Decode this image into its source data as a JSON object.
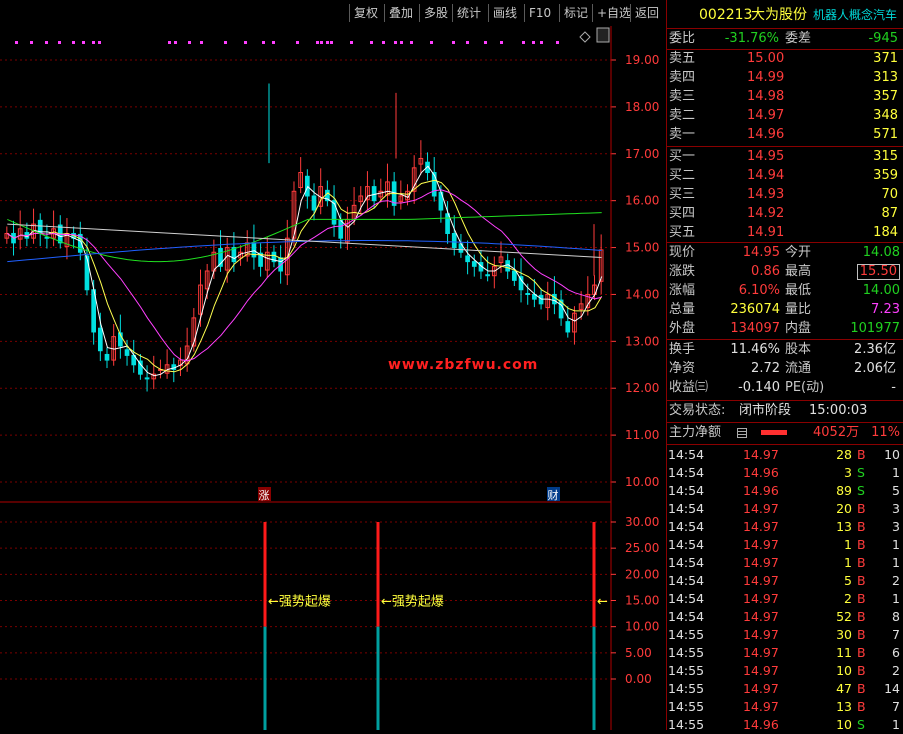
{
  "toolbar": {
    "buttons": [
      "复权",
      "叠加",
      "多股",
      "统计",
      "画线",
      "F10",
      "标记",
      "+自选",
      "返回"
    ]
  },
  "chart": {
    "price_axis": [
      "19.00",
      "18.00",
      "17.00",
      "16.00",
      "15.00",
      "14.00",
      "13.00",
      "12.00",
      "11.00",
      "10.00"
    ],
    "indicator_axis": [
      "30.00",
      "25.00",
      "20.00",
      "15.00",
      "10.00",
      "5.00",
      "0.00"
    ],
    "markers": [
      "涨",
      "财"
    ],
    "signal_label": "←强势起爆",
    "signal_arrow_label": "←",
    "watermark": "www.zbzfwu.com"
  },
  "quote": {
    "code": "002213",
    "name": "大为股份",
    "concept": "机器人概念汽车",
    "weibi_label": "委比",
    "weibi_value": "-31.76%",
    "weicha_label": "委差",
    "weicha_value": "-945",
    "asks": [
      {
        "label": "卖五",
        "price": "15.00",
        "vol": "371"
      },
      {
        "label": "卖四",
        "price": "14.99",
        "vol": "313"
      },
      {
        "label": "卖三",
        "price": "14.98",
        "vol": "357"
      },
      {
        "label": "卖二",
        "price": "14.97",
        "vol": "348"
      },
      {
        "label": "卖一",
        "price": "14.96",
        "vol": "571"
      }
    ],
    "bids": [
      {
        "label": "买一",
        "price": "14.95",
        "vol": "315"
      },
      {
        "label": "买二",
        "price": "14.94",
        "vol": "359"
      },
      {
        "label": "买三",
        "price": "14.93",
        "vol": "70"
      },
      {
        "label": "买四",
        "price": "14.92",
        "vol": "87"
      },
      {
        "label": "买五",
        "price": "14.91",
        "vol": "184"
      }
    ],
    "stats": [
      {
        "l1": "现价",
        "v1": "14.95",
        "l2": "今开",
        "v2": "14.08"
      },
      {
        "l1": "涨跌",
        "v1": "0.86",
        "l2": "最高",
        "v2": "15.50"
      },
      {
        "l1": "涨幅",
        "v1": "6.10%",
        "l2": "最低",
        "v2": "14.00"
      },
      {
        "l1": "总量",
        "v1": "236074",
        "l2": "量比",
        "v2": "7.23"
      },
      {
        "l1": "外盘",
        "v1": "134097",
        "l2": "内盘",
        "v2": "101977"
      }
    ],
    "stats2": [
      {
        "l1": "换手",
        "v1": "11.46%",
        "l2": "股本",
        "v2": "2.36亿"
      },
      {
        "l1": "净资",
        "v1": "2.72",
        "l2": "流通",
        "v2": "2.06亿"
      },
      {
        "l1": "收益㈢",
        "v1": "-0.140",
        "l2": "PE(动)",
        "v2": "-"
      }
    ],
    "trade_status_label": "交易状态:",
    "trade_status_value": "闭市阶段",
    "trade_status_time": "15:00:03",
    "main_flow_label": "主力净额",
    "main_flow_value": "4052万",
    "main_flow_pct": "11%",
    "ticks": [
      {
        "t": "14:54",
        "p": "14.97",
        "v": "28",
        "d": "B",
        "n": "10"
      },
      {
        "t": "14:54",
        "p": "14.96",
        "v": "3",
        "d": "S",
        "n": "1"
      },
      {
        "t": "14:54",
        "p": "14.96",
        "v": "89",
        "d": "S",
        "n": "5"
      },
      {
        "t": "14:54",
        "p": "14.97",
        "v": "20",
        "d": "B",
        "n": "3"
      },
      {
        "t": "14:54",
        "p": "14.97",
        "v": "13",
        "d": "B",
        "n": "3"
      },
      {
        "t": "14:54",
        "p": "14.97",
        "v": "1",
        "d": "B",
        "n": "1"
      },
      {
        "t": "14:54",
        "p": "14.97",
        "v": "1",
        "d": "B",
        "n": "1"
      },
      {
        "t": "14:54",
        "p": "14.97",
        "v": "5",
        "d": "B",
        "n": "2"
      },
      {
        "t": "14:54",
        "p": "14.97",
        "v": "2",
        "d": "B",
        "n": "1"
      },
      {
        "t": "14:54",
        "p": "14.97",
        "v": "52",
        "d": "B",
        "n": "8"
      },
      {
        "t": "14:55",
        "p": "14.97",
        "v": "30",
        "d": "B",
        "n": "7"
      },
      {
        "t": "14:55",
        "p": "14.97",
        "v": "11",
        "d": "B",
        "n": "6"
      },
      {
        "t": "14:55",
        "p": "14.97",
        "v": "10",
        "d": "B",
        "n": "2"
      },
      {
        "t": "14:55",
        "p": "14.97",
        "v": "47",
        "d": "B",
        "n": "14"
      },
      {
        "t": "14:55",
        "p": "14.97",
        "v": "13",
        "d": "B",
        "n": "7"
      },
      {
        "t": "14:55",
        "p": "14.96",
        "v": "10",
        "d": "S",
        "n": "1"
      }
    ]
  },
  "colors": {
    "up": "#ff3b3b",
    "down": "#00e0e0",
    "ma5": "#ffffff",
    "ma10": "#ffff50",
    "ma20": "#ff40ff",
    "ma60": "#20e020",
    "ma120": "#2060ff",
    "ma250": "#d0d0d0"
  }
}
